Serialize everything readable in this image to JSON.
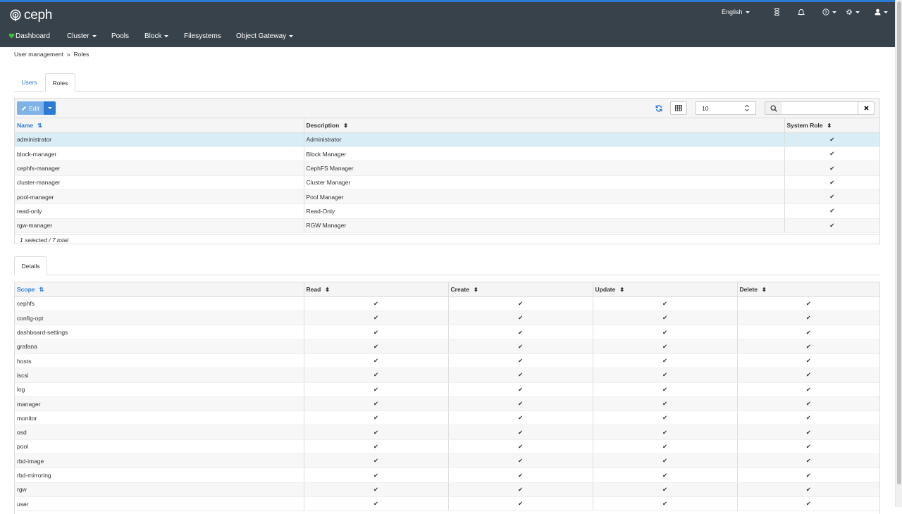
{
  "brand": {
    "name": "ceph"
  },
  "utility": {
    "language": "English",
    "icons": [
      "hourglass-icon",
      "bell-icon",
      "help-icon",
      "gear-icon",
      "user-icon"
    ]
  },
  "nav": {
    "items": [
      {
        "label": "Dashboard",
        "icon": "heart-icon",
        "dropdown": false
      },
      {
        "label": "Cluster",
        "dropdown": true
      },
      {
        "label": "Pools",
        "dropdown": false
      },
      {
        "label": "Block",
        "dropdown": true
      },
      {
        "label": "Filesystems",
        "dropdown": false
      },
      {
        "label": "Object Gateway",
        "dropdown": true
      }
    ]
  },
  "breadcrumb": {
    "parent": "User management",
    "separator": "»",
    "current": "Roles"
  },
  "tabs": {
    "users": "Users",
    "roles": "Roles"
  },
  "toolbar": {
    "edit_label": "Edit",
    "page_size": "10",
    "search_placeholder": ""
  },
  "roles_table": {
    "columns": {
      "name": "Name",
      "description": "Description",
      "system_role": "System Role"
    },
    "rows": [
      {
        "name": "administrator",
        "description": "Administrator",
        "system": "✔"
      },
      {
        "name": "block-manager",
        "description": "Block Manager",
        "system": "✔"
      },
      {
        "name": "cephfs-manager",
        "description": "CephFS Manager",
        "system": "✔"
      },
      {
        "name": "cluster-manager",
        "description": "Cluster Manager",
        "system": "✔"
      },
      {
        "name": "pool-manager",
        "description": "Pool Manager",
        "system": "✔"
      },
      {
        "name": "read-only",
        "description": "Read-Only",
        "system": "✔"
      },
      {
        "name": "rgw-manager",
        "description": "RGW Manager",
        "system": "✔"
      }
    ],
    "footer": "1 selected / 7 total"
  },
  "details": {
    "tab_label": "Details",
    "columns": {
      "scope": "Scope",
      "read": "Read",
      "create": "Create",
      "update": "Update",
      "delete": "Delete"
    },
    "rows": [
      {
        "scope": "cephfs",
        "read": "✔",
        "create": "✔",
        "update": "✔",
        "delete": "✔"
      },
      {
        "scope": "config-opt",
        "read": "✔",
        "create": "✔",
        "update": "✔",
        "delete": "✔"
      },
      {
        "scope": "dashboard-settings",
        "read": "✔",
        "create": "✔",
        "update": "✔",
        "delete": "✔"
      },
      {
        "scope": "grafana",
        "read": "✔",
        "create": "✔",
        "update": "✔",
        "delete": "✔"
      },
      {
        "scope": "hosts",
        "read": "✔",
        "create": "✔",
        "update": "✔",
        "delete": "✔"
      },
      {
        "scope": "iscsi",
        "read": "✔",
        "create": "✔",
        "update": "✔",
        "delete": "✔"
      },
      {
        "scope": "log",
        "read": "✔",
        "create": "✔",
        "update": "✔",
        "delete": "✔"
      },
      {
        "scope": "manager",
        "read": "✔",
        "create": "✔",
        "update": "✔",
        "delete": "✔"
      },
      {
        "scope": "monitor",
        "read": "✔",
        "create": "✔",
        "update": "✔",
        "delete": "✔"
      },
      {
        "scope": "osd",
        "read": "✔",
        "create": "✔",
        "update": "✔",
        "delete": "✔"
      },
      {
        "scope": "pool",
        "read": "✔",
        "create": "✔",
        "update": "✔",
        "delete": "✔"
      },
      {
        "scope": "rbd-image",
        "read": "✔",
        "create": "✔",
        "update": "✔",
        "delete": "✔"
      },
      {
        "scope": "rbd-mirroring",
        "read": "✔",
        "create": "✔",
        "update": "✔",
        "delete": "✔"
      },
      {
        "scope": "rgw",
        "read": "✔",
        "create": "✔",
        "update": "✔",
        "delete": "✔"
      },
      {
        "scope": "user",
        "read": "✔",
        "create": "✔",
        "update": "✔",
        "delete": "✔"
      }
    ]
  },
  "colors": {
    "navbar": "#37424a",
    "accent": "#2b7bd6",
    "heart": "#3dbb3d",
    "selected_row": "#d9edf7"
  }
}
